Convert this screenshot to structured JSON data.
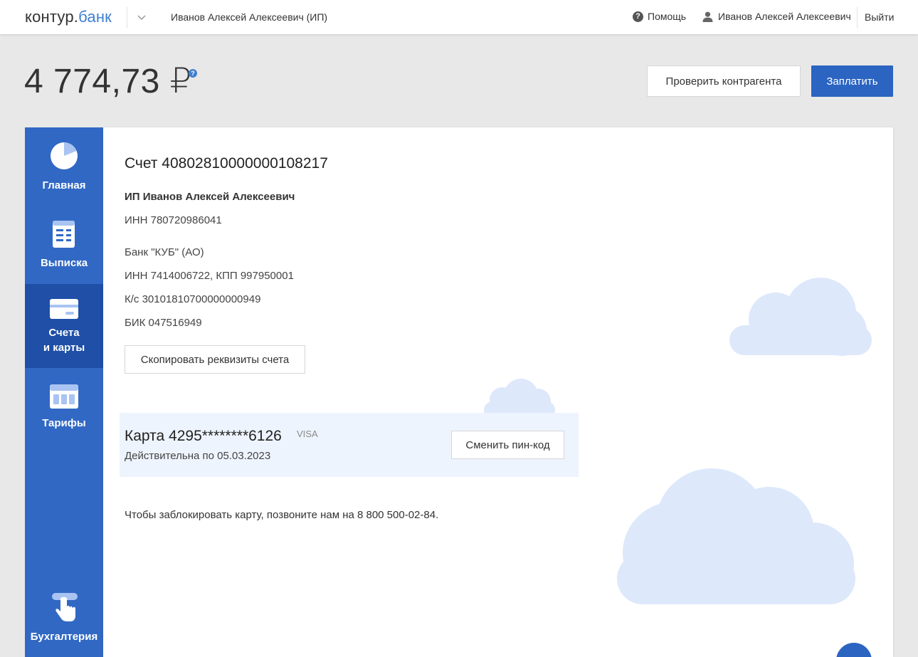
{
  "header": {
    "logo_prefix": "к",
    "logo_o": "о",
    "logo_middle": "нтур.",
    "logo_accent": "банк",
    "company": "Иванов Алексей Алексеевич (ИП)",
    "help": "Помощь",
    "user": "Иванов Алексей Алексеевич",
    "logout": "Выйти"
  },
  "balance": {
    "amount": "4 774,73 ₽",
    "help_glyph": "?"
  },
  "actions": {
    "check_label": "Проверить контрагента",
    "pay_label": "Заплатить"
  },
  "sidebar": {
    "items": [
      {
        "label": "Главная",
        "icon": "pie-chart-icon"
      },
      {
        "label": "Выписка",
        "icon": "statement-icon"
      },
      {
        "label_1": "Счета",
        "label_2": "и карты",
        "icon": "card-icon",
        "active": true
      },
      {
        "label": "Тарифы",
        "icon": "tariffs-icon"
      },
      {
        "label": "Бухгалтерия",
        "icon": "hand-pointer-icon"
      }
    ]
  },
  "account": {
    "title": "Счет 40802810000000108217",
    "owner": "ИП Иванов Алексей Алексеевич",
    "owner_inn": "ИНН 780720986041",
    "bank_name": "Банк \"КУБ\" (АО)",
    "bank_inn_kpp": "ИНН 7414006722, КПП 997950001",
    "corr_account": "К/с 30101810700000000949",
    "bik": "БИК 047516949",
    "copy_label": "Скопировать реквизиты счета"
  },
  "card": {
    "number": "Карта 4295********6126",
    "brand": "VISA",
    "valid": "Действительна по 05.03.2023",
    "change_pin_label": "Сменить пин-код"
  },
  "block_note": "Чтобы заблокировать карту, позвоните нам на 8 800 500-02-84.",
  "colors": {
    "primary": "#2b64c1",
    "sidebar": "#3168c4",
    "sidebar_active": "#1f4fa7",
    "cloud": "#dde8fb",
    "card_block": "#eef4fd"
  }
}
